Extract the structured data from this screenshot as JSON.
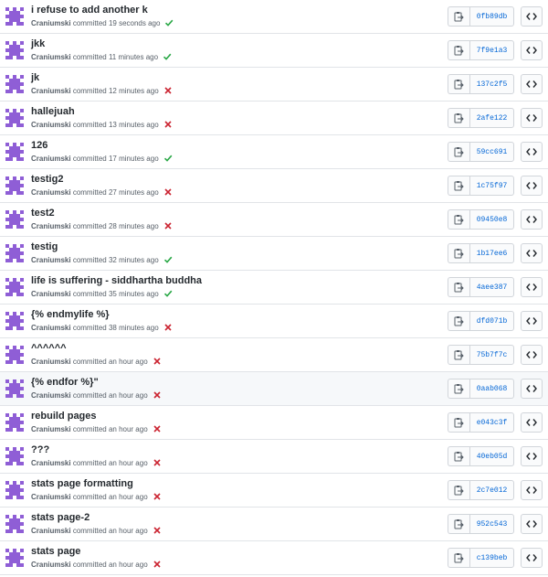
{
  "colors": {
    "avatar": "#8f5ed6",
    "success": "#28a745",
    "failure": "#cb2431",
    "link": "#0366d6"
  },
  "icons": {
    "copy": "clipboard-icon",
    "browse": "code-icon",
    "success": "check-icon",
    "failure": "x-icon"
  },
  "commits": [
    {
      "message": "i refuse to add another k",
      "author": "Craniumski",
      "verb": "committed",
      "time": "19 seconds ago",
      "status": "success",
      "sha": "0fb89db"
    },
    {
      "message": "jkk",
      "author": "Craniumski",
      "verb": "committed",
      "time": "11 minutes ago",
      "status": "success",
      "sha": "7f9e1a3"
    },
    {
      "message": "jk",
      "author": "Craniumski",
      "verb": "committed",
      "time": "12 minutes ago",
      "status": "failure",
      "sha": "137c2f5"
    },
    {
      "message": "hallejuah",
      "author": "Craniumski",
      "verb": "committed",
      "time": "13 minutes ago",
      "status": "failure",
      "sha": "2afe122"
    },
    {
      "message": "126",
      "author": "Craniumski",
      "verb": "committed",
      "time": "17 minutes ago",
      "status": "success",
      "sha": "59cc691"
    },
    {
      "message": "testig2",
      "author": "Craniumski",
      "verb": "committed",
      "time": "27 minutes ago",
      "status": "failure",
      "sha": "1c75f97"
    },
    {
      "message": "test2",
      "author": "Craniumski",
      "verb": "committed",
      "time": "28 minutes ago",
      "status": "failure",
      "sha": "09450e8"
    },
    {
      "message": "testig",
      "author": "Craniumski",
      "verb": "committed",
      "time": "32 minutes ago",
      "status": "success",
      "sha": "1b17ee6"
    },
    {
      "message": "life is suffering - siddhartha buddha",
      "author": "Craniumski",
      "verb": "committed",
      "time": "35 minutes ago",
      "status": "success",
      "sha": "4aee387"
    },
    {
      "message": "{% endmylife %}",
      "author": "Craniumski",
      "verb": "committed",
      "time": "38 minutes ago",
      "status": "failure",
      "sha": "dfd071b"
    },
    {
      "message": "^^^^^^",
      "author": "Craniumski",
      "verb": "committed",
      "time": "an hour ago",
      "status": "failure",
      "sha": "75b7f7c"
    },
    {
      "message": "{% endfor %}\"",
      "author": "Craniumski",
      "verb": "committed",
      "time": "an hour ago",
      "status": "failure",
      "sha": "0aab068",
      "highlight": true
    },
    {
      "message": "rebuild pages",
      "author": "Craniumski",
      "verb": "committed",
      "time": "an hour ago",
      "status": "failure",
      "sha": "e043c3f"
    },
    {
      "message": "???",
      "author": "Craniumski",
      "verb": "committed",
      "time": "an hour ago",
      "status": "failure",
      "sha": "40eb05d"
    },
    {
      "message": "stats page formatting",
      "author": "Craniumski",
      "verb": "committed",
      "time": "an hour ago",
      "status": "failure",
      "sha": "2c7e012"
    },
    {
      "message": "stats page-2",
      "author": "Craniumski",
      "verb": "committed",
      "time": "an hour ago",
      "status": "failure",
      "sha": "952c543"
    },
    {
      "message": "stats page",
      "author": "Craniumski",
      "verb": "committed",
      "time": "an hour ago",
      "status": "failure",
      "sha": "c139beb"
    }
  ]
}
